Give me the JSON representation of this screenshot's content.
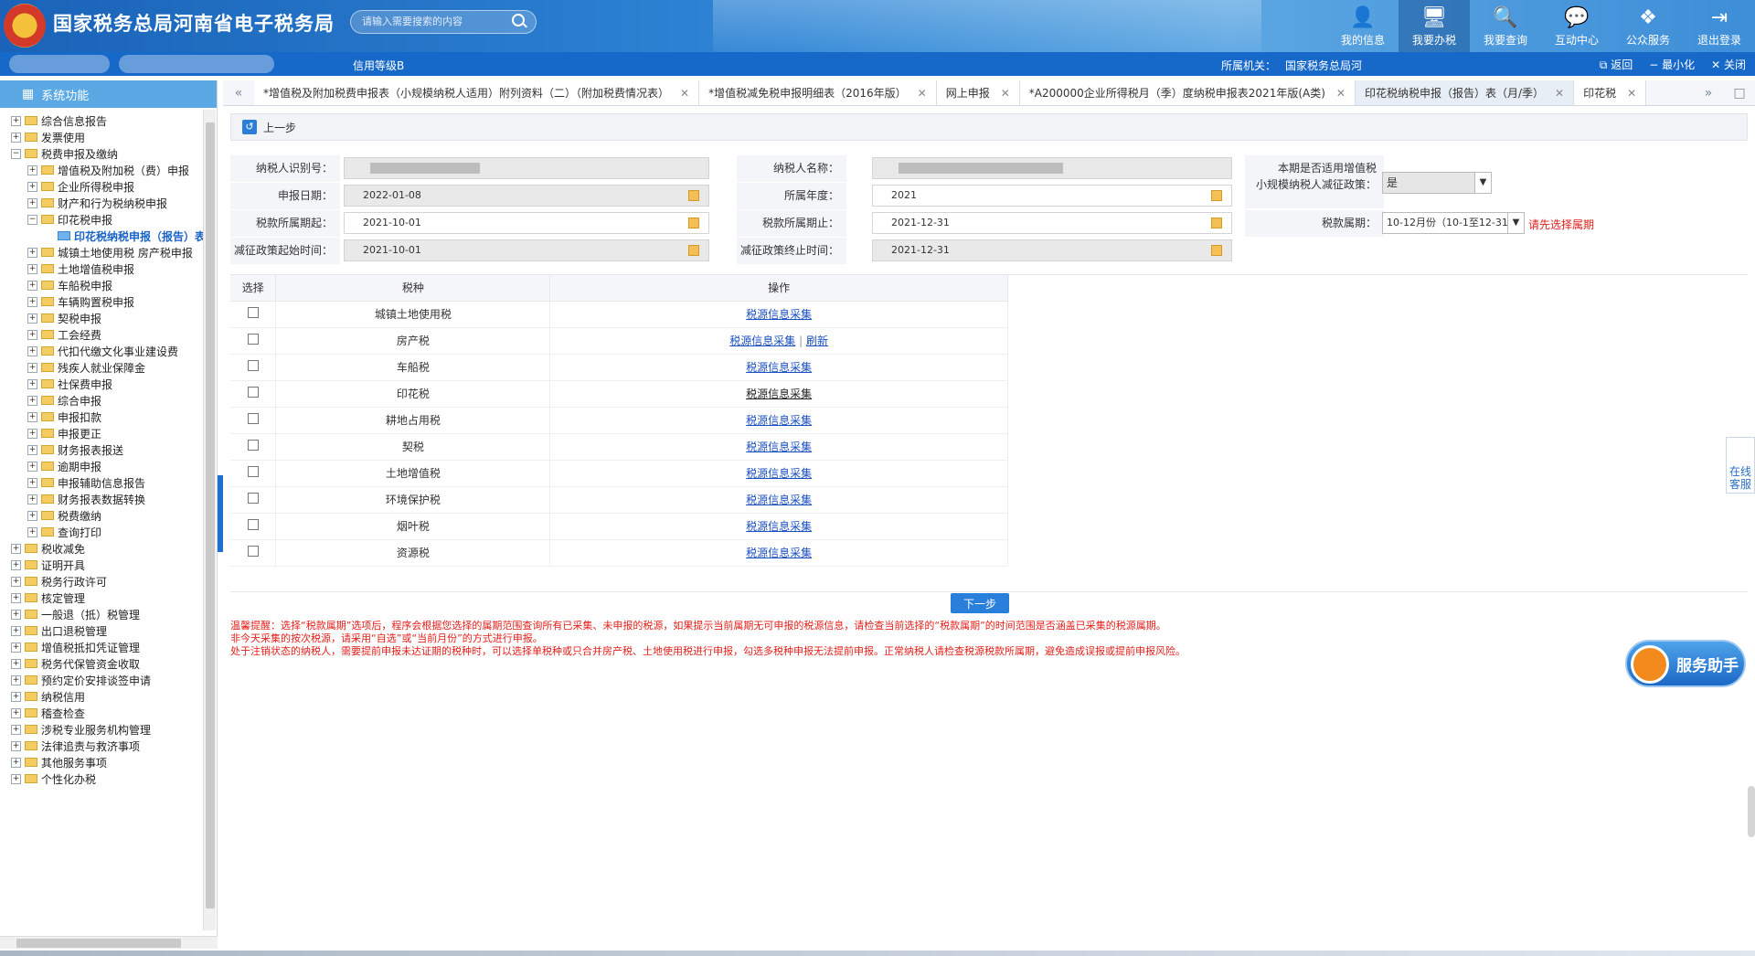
{
  "header": {
    "site_title": "国家税务总局河南省电子税务局",
    "search_placeholder": "请输入需要搜索的内容",
    "nav": [
      {
        "label": "我的信息",
        "icon": "user-icon"
      },
      {
        "label": "我要办税",
        "icon": "monitor-icon"
      },
      {
        "label": "我要查询",
        "icon": "doc-search-icon"
      },
      {
        "label": "互动中心",
        "icon": "chat-icon"
      },
      {
        "label": "公众服务",
        "icon": "layers-icon"
      },
      {
        "label": "退出登录",
        "icon": "logout-icon"
      }
    ]
  },
  "subbar": {
    "credit": "信用等级B",
    "org_label": "所属机关：",
    "org_value": "国家税务总局河",
    "back": "返回",
    "minimize": "最小化",
    "close": "关闭"
  },
  "sidebar": {
    "title": "系统功能",
    "items": [
      {
        "label": "综合信息报告",
        "depth": 0,
        "pm": "+"
      },
      {
        "label": "发票使用",
        "depth": 0,
        "pm": "+"
      },
      {
        "label": "税费申报及缴纳",
        "depth": 0,
        "pm": "−"
      },
      {
        "label": "增值税及附加税（费）申报",
        "depth": 1,
        "pm": "+"
      },
      {
        "label": "企业所得税申报",
        "depth": 1,
        "pm": "+"
      },
      {
        "label": "财产和行为税纳税申报",
        "depth": 1,
        "pm": "+"
      },
      {
        "label": "印花税申报",
        "depth": 1,
        "pm": "−"
      },
      {
        "label": "印花税纳税申报（报告）表",
        "depth": 2,
        "pm": ""
      },
      {
        "label": "城镇土地使用税 房产税申报",
        "depth": 1,
        "pm": "+"
      },
      {
        "label": "土地增值税申报",
        "depth": 1,
        "pm": "+"
      },
      {
        "label": "车船税申报",
        "depth": 1,
        "pm": "+"
      },
      {
        "label": "车辆购置税申报",
        "depth": 1,
        "pm": "+"
      },
      {
        "label": "契税申报",
        "depth": 1,
        "pm": "+"
      },
      {
        "label": "工会经费",
        "depth": 1,
        "pm": "+"
      },
      {
        "label": "代扣代缴文化事业建设费",
        "depth": 1,
        "pm": "+"
      },
      {
        "label": "残疾人就业保障金",
        "depth": 1,
        "pm": "+"
      },
      {
        "label": "社保费申报",
        "depth": 1,
        "pm": "+"
      },
      {
        "label": "综合申报",
        "depth": 1,
        "pm": "+"
      },
      {
        "label": "申报扣款",
        "depth": 1,
        "pm": "+"
      },
      {
        "label": "申报更正",
        "depth": 1,
        "pm": "+"
      },
      {
        "label": "财务报表报送",
        "depth": 1,
        "pm": "+"
      },
      {
        "label": "逾期申报",
        "depth": 1,
        "pm": "+"
      },
      {
        "label": "申报辅助信息报告",
        "depth": 1,
        "pm": "+"
      },
      {
        "label": "财务报表数据转换",
        "depth": 1,
        "pm": "+"
      },
      {
        "label": "税费缴纳",
        "depth": 1,
        "pm": "+"
      },
      {
        "label": "查询打印",
        "depth": 1,
        "pm": "+"
      },
      {
        "label": "税收减免",
        "depth": 0,
        "pm": "+"
      },
      {
        "label": "证明开具",
        "depth": 0,
        "pm": "+"
      },
      {
        "label": "税务行政许可",
        "depth": 0,
        "pm": "+"
      },
      {
        "label": "核定管理",
        "depth": 0,
        "pm": "+"
      },
      {
        "label": "一般退（抵）税管理",
        "depth": 0,
        "pm": "+"
      },
      {
        "label": "出口退税管理",
        "depth": 0,
        "pm": "+"
      },
      {
        "label": "增值税抵扣凭证管理",
        "depth": 0,
        "pm": "+"
      },
      {
        "label": "税务代保管资金收取",
        "depth": 0,
        "pm": "+"
      },
      {
        "label": "预约定价安排谈签申请",
        "depth": 0,
        "pm": "+"
      },
      {
        "label": "纳税信用",
        "depth": 0,
        "pm": "+"
      },
      {
        "label": "稽查检查",
        "depth": 0,
        "pm": "+"
      },
      {
        "label": "涉税专业服务机构管理",
        "depth": 0,
        "pm": "+"
      },
      {
        "label": "法律追责与救济事项",
        "depth": 0,
        "pm": "+"
      },
      {
        "label": "其他服务事项",
        "depth": 0,
        "pm": "+"
      },
      {
        "label": "个性化办税",
        "depth": 0,
        "pm": "+"
      }
    ]
  },
  "tabs": [
    {
      "label": "*增值税及附加税费申报表（小规模纳税人适用）附列资料（二）（附加税费情况表）",
      "active": false
    },
    {
      "label": "*增值税减免税申报明细表（2016年版）",
      "active": false
    },
    {
      "label": "网上申报",
      "active": false
    },
    {
      "label": "*A200000企业所得税月（季）度纳税申报表2021年版(A类)",
      "active": false
    },
    {
      "label": "印花税纳税申报（报告）表（月/季）",
      "active": true
    },
    {
      "label": "印花税",
      "active": false
    }
  ],
  "toolbar": {
    "prev_label": "上一步"
  },
  "form": {
    "taxpayer_id_label": "纳税人识别号：",
    "taxpayer_name_label": "纳税人名称：",
    "policy_label_1": "本期是否适用增值税",
    "policy_label_2": "小规模纳税人减征政策：",
    "policy_value": "是",
    "declare_date_label": "申报日期：",
    "declare_date": "2022-01-08",
    "year_label": "所属年度：",
    "year": "2021",
    "period_start_label": "税款所属期起：",
    "period_start": "2021-10-01",
    "period_end_label": "税款所属期止：",
    "period_end": "2021-12-31",
    "tax_period_label": "税款属期：",
    "tax_period_value": "10-12月份（10-1至12-31）",
    "tax_period_hint": "请先选择属期",
    "policy_start_label": "减征政策起始时间：",
    "policy_start": "2021-10-01",
    "policy_end_label": "减征政策终止时间：",
    "policy_end": "2021-12-31"
  },
  "table": {
    "headers": [
      "选择",
      "税种",
      "操作"
    ],
    "rows": [
      {
        "tax": "城镇土地使用税",
        "action": "税源信息采集",
        "extra": "",
        "dark": false
      },
      {
        "tax": "房产税",
        "action": "税源信息采集",
        "extra": "刷新",
        "dark": false
      },
      {
        "tax": "车船税",
        "action": "税源信息采集",
        "extra": "",
        "dark": false
      },
      {
        "tax": "印花税",
        "action": "税源信息采集",
        "extra": "",
        "dark": true
      },
      {
        "tax": "耕地占用税",
        "action": "税源信息采集",
        "extra": "",
        "dark": false
      },
      {
        "tax": "契税",
        "action": "税源信息采集",
        "extra": "",
        "dark": false
      },
      {
        "tax": "土地增值税",
        "action": "税源信息采集",
        "extra": "",
        "dark": false
      },
      {
        "tax": "环境保护税",
        "action": "税源信息采集",
        "extra": "",
        "dark": false
      },
      {
        "tax": "烟叶税",
        "action": "税源信息采集",
        "extra": "",
        "dark": false
      },
      {
        "tax": "资源税",
        "action": "税源信息采集",
        "extra": "",
        "dark": false
      }
    ]
  },
  "next_label": "下一步",
  "notice": [
    "温馨提醒：选择“税款属期”选项后，程序会根据您选择的属期范围查询所有已采集、未申报的税源，如果提示当前属期无可申报的税源信息，请检查当前选择的“税款属期”的时间范围是否涵盖已采集的税源属期。",
    "非今天采集的按次税源，请采用“自选”或“当前月份”的方式进行申报。",
    "处于注销状态的纳税人，需要提前申报未达证期的税种时，可以选择单税种或只合并房产税、土地使用税进行申报，勾选多税种申报无法提前申报。正常纳税人请检查税源税款所属期，避免造成误报或提前申报风险。"
  ],
  "float": {
    "online_label": "在线客服",
    "assistant_label": "服务助手"
  },
  "colors": {
    "primary": "#1769c9",
    "warning": "#e3201b",
    "link": "#1a4fc0"
  }
}
